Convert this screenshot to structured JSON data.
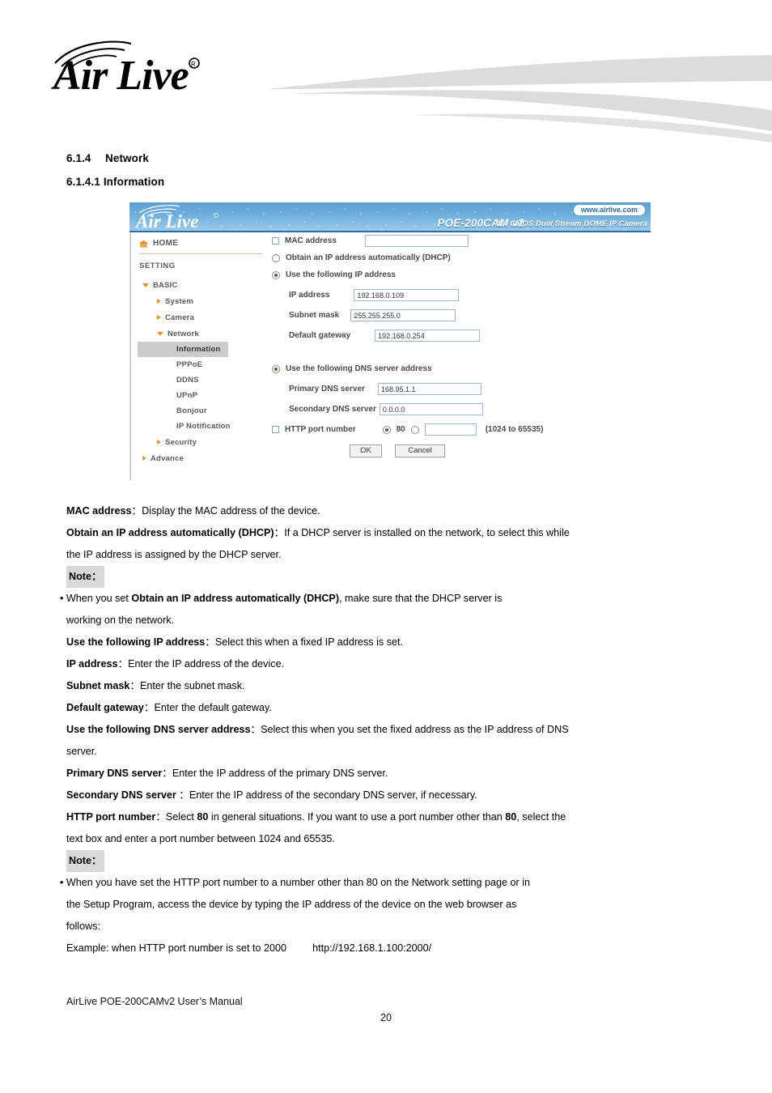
{
  "document": {
    "logo_alt": "AirLive",
    "footer": "AirLive POE-200CAMv2 User’s Manual",
    "page_number": "20"
  },
  "headings": {
    "section_number": "6.1.4",
    "section_title": "Network",
    "subsection": "6.1.4.1 Information"
  },
  "camera_ui": {
    "logo_text": "AirLive",
    "model": "POE-200CAM v2",
    "subtitle": "1/4 CMOS Dual Stream DOME IP Camera",
    "url_badge": "www.airlive.com",
    "sidebar": {
      "home": "HOME",
      "setting": "SETTING",
      "items": [
        {
          "label": "BASIC",
          "level": 1,
          "marker": "down"
        },
        {
          "label": "System",
          "level": 2,
          "marker": "right"
        },
        {
          "label": "Camera",
          "level": 2,
          "marker": "right"
        },
        {
          "label": "Network",
          "level": 2,
          "marker": "down"
        },
        {
          "label": "Information",
          "level": 3,
          "marker": "none",
          "selected": true
        },
        {
          "label": "PPPoE",
          "level": 3,
          "marker": "none"
        },
        {
          "label": "DDNS",
          "level": 3,
          "marker": "none"
        },
        {
          "label": "UPnP",
          "level": 3,
          "marker": "none"
        },
        {
          "label": "Bonjour",
          "level": 3,
          "marker": "none"
        },
        {
          "label": "IP Notification",
          "level": 3,
          "marker": "none"
        },
        {
          "label": "Security",
          "level": 2,
          "marker": "right"
        },
        {
          "label": "Advance",
          "level": 1,
          "marker": "right"
        }
      ]
    },
    "form": {
      "mac_label": "MAC address",
      "mac_value": "",
      "dhcp_label": "Obtain an IP address automatically (DHCP)",
      "static_label": "Use the following IP address",
      "ip_label": "IP address",
      "ip_value": "192.168.0.109",
      "subnet_label": "Subnet mask",
      "subnet_value": "255.255.255.0",
      "gateway_label": "Default gateway",
      "gateway_value": "192.168.0.254",
      "dns_static_label": "Use the following DNS server address",
      "primary_dns_label": "Primary DNS server",
      "primary_dns_value": "168.95.1.1",
      "secondary_dns_label": "Secondary DNS server",
      "secondary_dns_value": "0.0.0.0",
      "http_port_label": "HTTP port number",
      "http_port_80": "80",
      "http_port_custom_value": "",
      "http_port_hint": "(1024 to 65535)",
      "ok_label": "OK",
      "cancel_label": "Cancel"
    }
  },
  "body": {
    "mac_term": "MAC address",
    "mac_desc": "：Display the MAC address of the device.",
    "dhcp_term": "Obtain an IP address automatically (DHCP)",
    "dhcp_desc": "：If a DHCP server is installed on the network, to select this while",
    "dhcp_desc2": "the IP address is assigned by the DHCP server.",
    "note1_label": "Note：",
    "note1_bullet_pre": "• When you set ",
    "note1_bullet_bold": "Obtain an IP address automatically (DHCP)",
    "note1_bullet_post": ", make sure that the DHCP server is",
    "note1_bullet_cont": "working on the network.",
    "static_term": "Use the following IP address",
    "static_desc": "：Select this when a fixed IP address is set.",
    "ip_term": "IP address",
    "ip_desc": "：Enter the IP address of the device.",
    "subnet_term": "Subnet mask",
    "subnet_desc": "：Enter the subnet mask.",
    "gateway_term": "Default gateway",
    "gateway_desc": "：Enter the default gateway.",
    "dns_term": "Use the following DNS server address",
    "dns_desc": "：Select this when you set the fixed address as the IP address of DNS",
    "dns_desc2": "server.",
    "pdns_term": "Primary DNS server",
    "pdns_desc": "：Enter the IP address of the primary DNS server.",
    "sdns_term": "Secondary DNS server",
    "sdns_desc": " ：Enter the IP address of the secondary DNS server, if necessary.",
    "http_term": "HTTP port number",
    "http_desc_a": "：Select ",
    "http_bold_1": "80",
    "http_desc_b": " in general situations. If you want to use a port number other than ",
    "http_bold_2": "80",
    "http_desc_c": ", select the",
    "http_desc2": "text box and enter a port number between 1024 and 65535.",
    "note2_label": "Note：",
    "note2_bullet": "• When you have set the HTTP port number to a number other than 80 on the Network setting page or in",
    "note2_bullet_cont1": "the Setup Program, access the device by typing the IP address of the device on the web browser as",
    "note2_bullet_cont2": "follows:",
    "example_text": "Example: when HTTP port number is set to 2000",
    "example_url": "http://192.168.1.100:2000/"
  },
  "colors": {
    "accent_orange": "#e8902a",
    "header_blue": "#6aaad9",
    "highlight_gray": "#cccccc",
    "note_gray": "#d9d9d9"
  }
}
